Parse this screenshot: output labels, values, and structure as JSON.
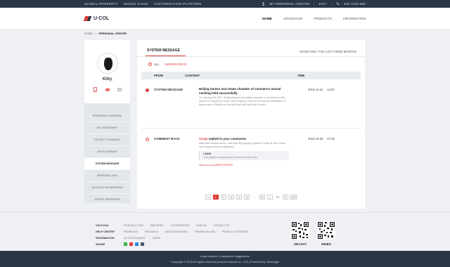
{
  "topbar": {
    "left_items": [
      "GLOBAL PROPERTY",
      "WHOLE CHAIN",
      "CUSTOMIZATION PLATFORM"
    ],
    "my_center": "MY PERSONAL CENTER",
    "exit": "EXIT",
    "phone": "400-1234-666"
  },
  "header": {
    "logo_text": "U·COL",
    "nav": [
      "HOME",
      "ADVANTAGE",
      "PRODUCTS",
      "INFORMATION"
    ],
    "active_nav": "HOME"
  },
  "breadcrumb": {
    "home": "HOME",
    "sep": ">",
    "current": "PERSONAL CENTER"
  },
  "sidebar": {
    "username": "Kitty",
    "menu": [
      "PERSONAL HOMEPAGE",
      "MY INVESTMENT",
      "PROJECT DYNAMICS",
      "INVITE FRIENDS",
      "SYSTEM MESSAGE",
      "PERSONAL DATA",
      "ACCOUNT INFORMATION",
      "MODIFY PASSWORD"
    ],
    "active": "SYSTEM MESSAGE"
  },
  "content": {
    "tab_title": "SYSTEM MESSAGE",
    "tab_note": "SHOW ONLY THE LAST THREE MONTHS",
    "filter_all": "ALL",
    "filter_read": "MARKED READ",
    "columns": {
      "from": "FROM",
      "content": "CONTENT",
      "time": "TIME"
    },
    "messages": [
      {
        "from": "SYSTEM MESSAGE",
        "title": "Beijing homes real estate chamber of commerce annual meeting held successfully",
        "text": "On January 18, 2017, Beijing homes real estate chamber of commerce to the theme of \"long-term's mind, never forget to move on the annual celebration of flying tower in Beijing on the first floor hall was held in lunch ...",
        "date": "2015-11-15",
        "time": "13:25",
        "read": false
      },
      {
        "from": "COMMENT BACK",
        "author": "Cindy",
        "title_suffix": "replied to your comments",
        "text": "Well said modest sense, I also like this property, good!!! it really is very cheap, very happy and your neighbors",
        "said_title": "I SAID",
        "said_text": "This project is super good!!! passed all field trips",
        "link": "http://yu-ucol.pl/8RQ7EF55SS",
        "date": "2015-10-06",
        "time": "07:48",
        "read": true
      }
    ],
    "pager": [
      "«",
      "1",
      "2",
      "3",
      "4",
      "5",
      "...",
      "10",
      "»"
    ],
    "pager_to": "TO",
    "pager_page": "8",
    "pager_go": "GO",
    "pager_active": "1"
  },
  "footer": {
    "rows": [
      {
        "label": "YUUCOOL",
        "items": [
          "INTRODUCTION",
          "PARTNERS",
          "COOPERATION",
          "JOIN US",
          "CONTACT US"
        ]
      },
      {
        "label": "HELP CENTER",
        "items": [
          "PROBLEMS",
          "FEEDBACK",
          "NEW GUIDELINES",
          "TRADING RULES",
          "PRIVACY STATEMENT"
        ]
      },
      {
        "label": "INFORMATION",
        "items": [
          "ACTIVITYINQUIRY",
          "NEWS"
        ]
      },
      {
        "label": "SHARE",
        "items": []
      }
    ],
    "qr1_label": "WECHAT",
    "qr2_label": "WEIBO",
    "bottom_line1": "Legal notices  |  Complaints Suggestions",
    "bottom_line2": "Copyright © 2015  All rights reserved yuucool network co., LTD  |  Powered by Xinhengjiu"
  },
  "colors": {
    "accent": "#e03a3a",
    "dark": "#2a3645"
  }
}
